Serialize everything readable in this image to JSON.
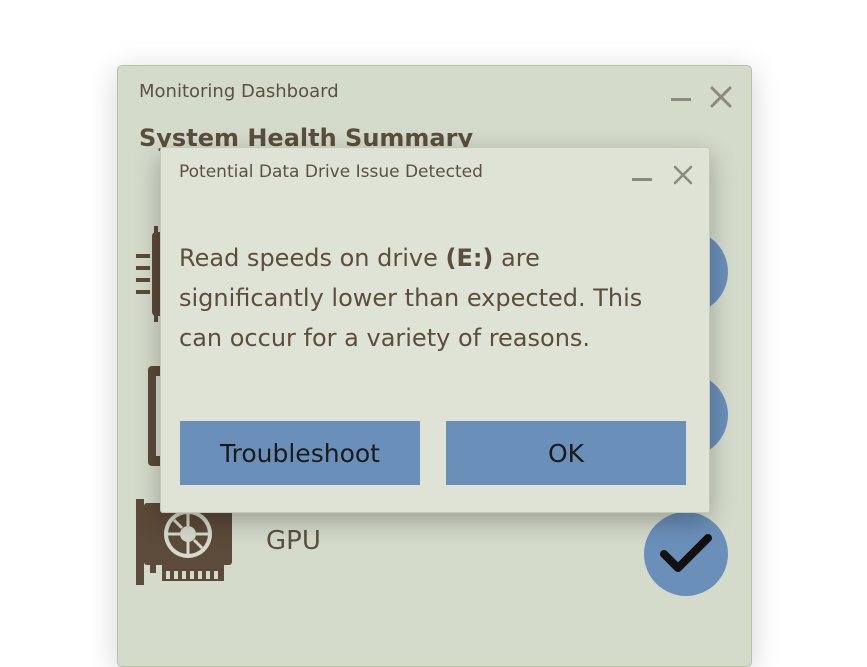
{
  "background_window": {
    "title": "Monitoring Dashboard",
    "heading": "System Health Summary",
    "rows": [
      {
        "icon": "cpu-chip-icon"
      },
      {
        "icon": "memory-module-icon"
      },
      {
        "icon": "gpu-card-icon",
        "label": "GPU",
        "status_icon": "checkmark-icon"
      }
    ]
  },
  "dialog": {
    "title": "Potential Data Drive Issue Detected",
    "message_before": "Read speeds on drive ",
    "message_drive": "(E:)",
    "message_after": " are significantly lower than expected. This can occur for a variety of reasons.",
    "buttons": {
      "troubleshoot": "Troubleshoot",
      "ok": "OK"
    }
  },
  "colors": {
    "window_bg": "#d5dbcb",
    "dialog_bg": "#dfe3d5",
    "accent": "#6a90ba",
    "text": "#5a4f3e",
    "icon": "#5c4a3a"
  }
}
